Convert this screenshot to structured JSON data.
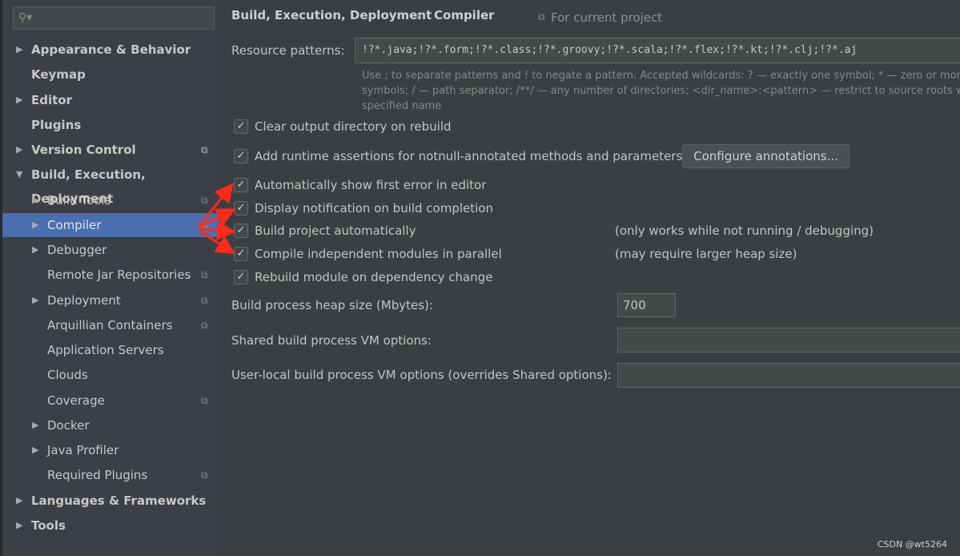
{
  "sidebar": {
    "search_placeholder": "",
    "items": [
      {
        "label": "Appearance & Behavior",
        "level": 0,
        "arrow": "▶"
      },
      {
        "label": "Keymap",
        "level": 0,
        "arrow": ""
      },
      {
        "label": "Editor",
        "level": 0,
        "arrow": "▶"
      },
      {
        "label": "Plugins",
        "level": 0,
        "arrow": ""
      },
      {
        "label": "Version Control",
        "level": 0,
        "arrow": "▶",
        "copy": true
      },
      {
        "label": "Build, Execution, Deployment",
        "level": 0,
        "arrow": "▼"
      },
      {
        "label": "Build Tools",
        "level": 1,
        "arrow": "▶",
        "copy": true
      },
      {
        "label": "Compiler",
        "level": 1,
        "arrow": "▶",
        "copy": true,
        "selected": true
      },
      {
        "label": "Debugger",
        "level": 1,
        "arrow": "▶"
      },
      {
        "label": "Remote Jar Repositories",
        "level": 1,
        "arrow": "",
        "copy": true
      },
      {
        "label": "Deployment",
        "level": 1,
        "arrow": "▶",
        "copy": true
      },
      {
        "label": "Arquillian Containers",
        "level": 1,
        "arrow": "",
        "copy": true
      },
      {
        "label": "Application Servers",
        "level": 1,
        "arrow": ""
      },
      {
        "label": "Clouds",
        "level": 1,
        "arrow": ""
      },
      {
        "label": "Coverage",
        "level": 1,
        "arrow": "",
        "copy": true
      },
      {
        "label": "Docker",
        "level": 1,
        "arrow": "▶"
      },
      {
        "label": "Java Profiler",
        "level": 1,
        "arrow": "▶"
      },
      {
        "label": "Required Plugins",
        "level": 1,
        "arrow": "",
        "copy": true
      },
      {
        "label": "Languages & Frameworks",
        "level": 0,
        "arrow": "▶"
      },
      {
        "label": "Tools",
        "level": 0,
        "arrow": "▶"
      }
    ]
  },
  "header": {
    "crumb1": "Build, Execution, Deployment",
    "separator": "›",
    "crumb2": "Compiler",
    "scope": "For current project"
  },
  "resource": {
    "label": "Resource patterns:",
    "value": "!?*.java;!?*.form;!?*.class;!?*.groovy;!?*.scala;!?*.flex;!?*.kt;!?*.clj;!?*.aj",
    "hint1": "Use ; to separate patterns and ! to negate a pattern. Accepted wildcards: ? — exactly one symbol; * — zero or more",
    "hint2": "symbols; / — path separator; /**/ — any number of directories; <dir_name>:<pattern> — restrict to source roots with the",
    "hint3": "specified name"
  },
  "options": [
    {
      "label": "Clear output directory on rebuild",
      "checked": true
    },
    {
      "label": "Add runtime assertions for notnull-annotated methods and parameters",
      "checked": true
    },
    {
      "label": "Automatically show first error in editor",
      "checked": true
    },
    {
      "label": "Display notification on build completion",
      "checked": true
    },
    {
      "label": "Build project automatically",
      "checked": true,
      "note": "(only works while not running / debugging)"
    },
    {
      "label": "Compile independent modules in parallel",
      "checked": true,
      "note": "(may require larger heap size)"
    },
    {
      "label": "Rebuild module on dependency change",
      "checked": true
    }
  ],
  "configure_button": "Configure annotations...",
  "heap": {
    "label": "Build process heap size (Mbytes):",
    "value": "700"
  },
  "shared_vm": {
    "label": "Shared build process VM options:",
    "value": ""
  },
  "user_vm": {
    "label": "User-local build process VM options (overrides Shared options):",
    "value": ""
  },
  "annotation_color": "#ff2a1a",
  "watermark": "CSDN @wt5264"
}
